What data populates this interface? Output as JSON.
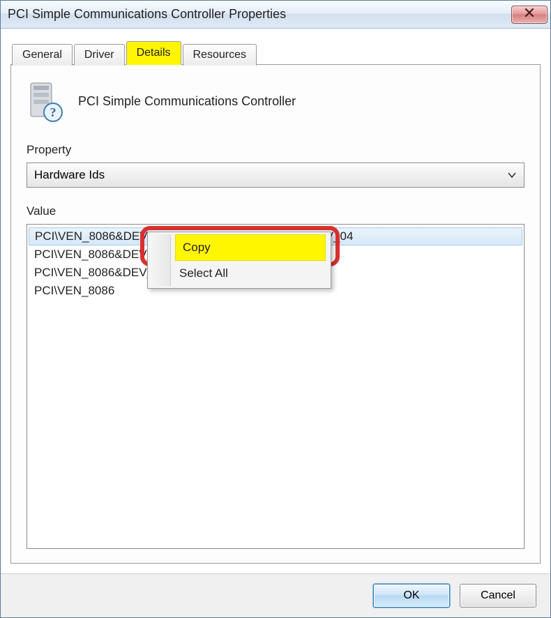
{
  "window": {
    "title": "PCI Simple Communications Controller Properties"
  },
  "tabs": {
    "items": [
      {
        "label": "General"
      },
      {
        "label": "Driver"
      },
      {
        "label": "Details"
      },
      {
        "label": "Resources"
      }
    ],
    "active_index": 2
  },
  "device": {
    "name": "PCI Simple Communications Controller"
  },
  "property": {
    "label": "Property",
    "selected": "Hardware Ids"
  },
  "value": {
    "label": "Value",
    "items": [
      "PCI\\VEN_8086&DEV_8C3A&SUBSYS_061C1028&REV_04",
      "PCI\\VEN_8086&DEV_8C3A&SUBSYS_061C1028",
      "PCI\\VEN_8086&DEV_8C3A",
      "PCI\\VEN_8086"
    ],
    "selected_index": 0
  },
  "context_menu": {
    "items": [
      {
        "label": "Copy"
      },
      {
        "label": "Select All"
      }
    ],
    "highlight_index": 0
  },
  "buttons": {
    "ok": "OK",
    "cancel": "Cancel"
  }
}
